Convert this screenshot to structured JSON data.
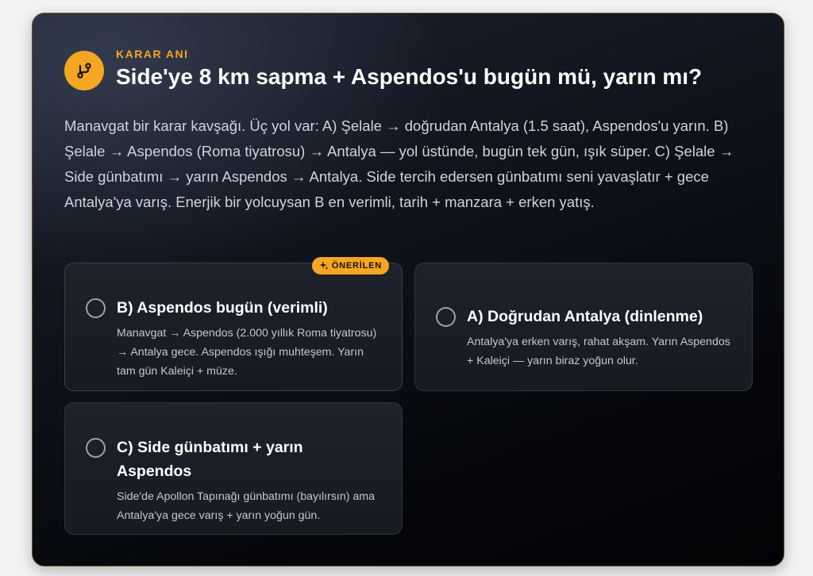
{
  "header": {
    "icon": "branch-icon",
    "eyebrow": "KARAR ANI",
    "title": "Side'ye 8 km sapma + Aspendos'u bugün mü, yarın mı?"
  },
  "description": "Manavgat bir karar kavşağı. Üç yol var: A) Şelale → doğrudan Antalya (1.5 saat), Aspendos'u yarın. B) Şelale → Aspendos (Roma tiyatrosu) → Antalya — yol üstünde, bugün tek gün, ışık süper. C) Şelale → Side günbatımı → yarın Aspendos → Antalya. Side tercih edersen günbatımı seni yavaşlatır + gece Antalya'ya varış. Enerjik bir yolcuysan B en verimli, tarih + manzara + erken yatış.",
  "options": [
    {
      "id": "B",
      "title": "B) Aspendos bugün (verimli)",
      "description": "Manavgat → Aspendos (2.000 yıllık Roma tiyatrosu) → Antalya gece. Aspendos ışığı muhteşem. Yarın tam gün Kaleiçi + müze.",
      "recommended": true,
      "badge": "ÖNERİLEN",
      "selected": false
    },
    {
      "id": "A",
      "title": "A) Doğrudan Antalya (dinlenme)",
      "description": "Antalya'ya erken varış, rahat akşam. Yarın Aspendos + Kaleiçi — yarın biraz yoğun olur.",
      "recommended": false,
      "selected": false
    },
    {
      "id": "C",
      "title": "C) Side günbatımı + yarın Aspendos",
      "description": "Side'de Apollon Tapınağı günbatımı (bayılırsın) ama Antalya'ya gece varış + yarın yoğun gün.",
      "recommended": false,
      "selected": false
    }
  ],
  "colors": {
    "accent": "#f5a623",
    "card_background": "#0b0e14",
    "option_background": "#1b1e26",
    "card_border": "#6b5226"
  }
}
